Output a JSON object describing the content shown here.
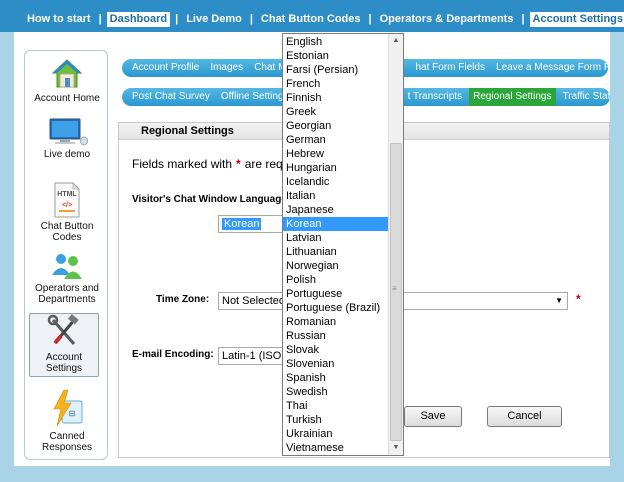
{
  "topnav": {
    "items": [
      {
        "label": "How to start",
        "active": false
      },
      {
        "label": "Dashboard",
        "active": true
      },
      {
        "label": "Live Demo",
        "active": false
      },
      {
        "label": "Chat Button Codes",
        "active": false
      },
      {
        "label": "Operators & Departments",
        "active": false
      },
      {
        "label": "Account Settings",
        "active": true
      }
    ]
  },
  "sidebar": {
    "items": [
      {
        "label": "Account Home",
        "icon": "house-icon"
      },
      {
        "label": "Live demo",
        "icon": "monitor-icon"
      },
      {
        "label": "Chat Button Codes",
        "icon": "html-code-icon"
      },
      {
        "label": "Operators and Departments",
        "icon": "operators-icon"
      },
      {
        "label": "Account Settings",
        "icon": "tools-icon",
        "active": true
      },
      {
        "label": "Canned Responses",
        "icon": "lightning-icon"
      }
    ]
  },
  "tabs_row1": [
    {
      "label": "Account Profile"
    },
    {
      "label": "Images"
    },
    {
      "label": "Chat M"
    },
    {
      "label": "hat Form Fields"
    },
    {
      "label": "Leave a Message Form Fields"
    }
  ],
  "tabs_row2": [
    {
      "label": "Post Chat Survey"
    },
    {
      "label": "Offline Settings"
    },
    {
      "label": "t Transcripts"
    },
    {
      "label": "Regional Settings",
      "active": true
    },
    {
      "label": "Traffic Stati"
    }
  ],
  "settings": {
    "title": "Regional Settings",
    "required_note_prefix": "Fields marked with",
    "required_star": "*",
    "required_note_suffix": "are req",
    "language_label": "Visitor's Chat Window Language",
    "language_value": "Korean",
    "timezone_label": "Time Zone:",
    "timezone_value": "Not Selected",
    "encoding_label": "E-mail Encoding:",
    "encoding_value": "Latin-1 (ISO",
    "save_label": "Save",
    "cancel_label": "Cancel"
  },
  "language_dropdown": {
    "options": [
      "English",
      "Estonian",
      "Farsi (Persian)",
      "French",
      "Finnish",
      "Greek",
      "Georgian",
      "German",
      "Hebrew",
      "Hungarian",
      "Icelandic",
      "Italian",
      "Japanese",
      "Korean",
      "Latvian",
      "Lithuanian",
      "Norwegian",
      "Polish",
      "Portuguese",
      "Portuguese (Brazil)",
      "Romanian",
      "Russian",
      "Slovak",
      "Slovenian",
      "Spanish",
      "Swedish",
      "Thai",
      "Turkish",
      "Ukrainian",
      "Vietnamese"
    ],
    "selected": "Korean"
  },
  "colors": {
    "nav_bg": "#2d8dc7",
    "tab_active": "#2aa63a",
    "selection": "#3399ff",
    "required": "#cc0000"
  }
}
